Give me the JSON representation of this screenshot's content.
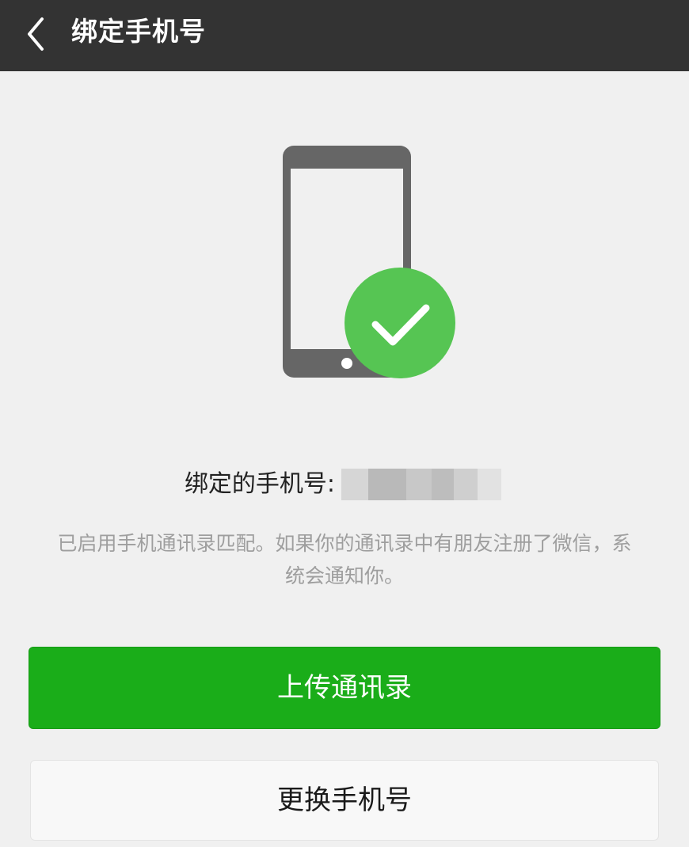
{
  "header": {
    "title": "绑定手机号",
    "back_icon": "chevron-left-icon"
  },
  "illustration": {
    "phone_icon": "smartphone-icon",
    "check_icon": "check-circle-icon",
    "check_color": "#56c553",
    "phone_color": "#666666"
  },
  "bound": {
    "label": "绑定的手机号:"
  },
  "info": {
    "line1": "已启用手机通讯录匹配。如果你的通讯录中有朋友注册了微信，系",
    "line2": "统会通知你。"
  },
  "actions": {
    "upload_label": "上传通讯录",
    "change_label": "更换手机号",
    "primary_color": "#1aad19"
  }
}
